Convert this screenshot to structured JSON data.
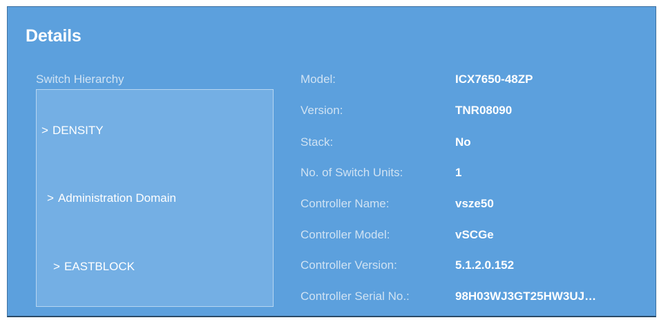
{
  "panel": {
    "title": "Details"
  },
  "hierarchy": {
    "label": "Switch Hierarchy",
    "items": [
      {
        "chevron": ">",
        "label": "DENSITY"
      },
      {
        "chevron": ">",
        "label": "Administration Domain"
      },
      {
        "chevron": ">",
        "label": "EASTBLOCK"
      }
    ]
  },
  "details": [
    {
      "key": "Model:",
      "value": "ICX7650-48ZP"
    },
    {
      "key": "Version:",
      "value": "TNR08090"
    },
    {
      "key": "Stack:",
      "value": "No"
    },
    {
      "key": "No. of Switch Units:",
      "value": "1"
    },
    {
      "key": "Controller Name:",
      "value": "vsze50"
    },
    {
      "key": "Controller Model:",
      "value": "vSCGe"
    },
    {
      "key": "Controller Version:",
      "value": "5.1.2.0.152"
    },
    {
      "key": "Controller Serial No.:",
      "value": "98H03WJ3GT25HW3UJ…"
    }
  ]
}
